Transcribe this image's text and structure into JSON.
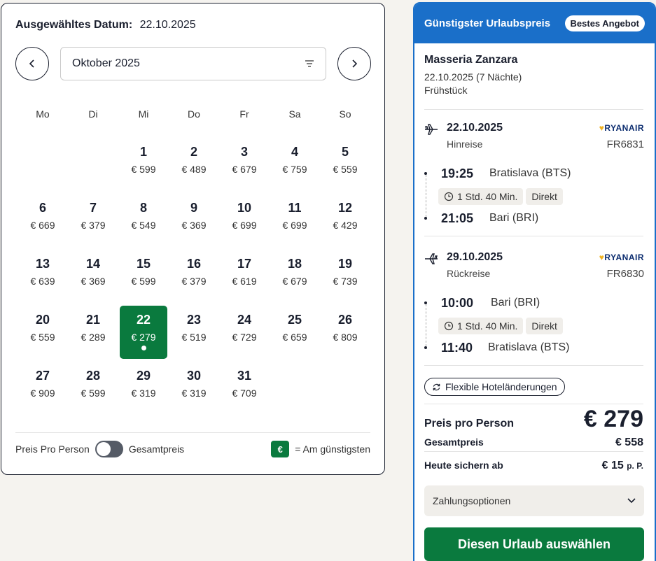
{
  "calendar": {
    "selected_label": "Ausgewähltes Datum:",
    "selected_value": "22.10.2025",
    "month": "Oktober 2025",
    "weekdays": [
      "Mo",
      "Di",
      "Mi",
      "Do",
      "Fr",
      "Sa",
      "So"
    ],
    "days": [
      {
        "d": "1",
        "p": "€ 599"
      },
      {
        "d": "2",
        "p": "€ 489"
      },
      {
        "d": "3",
        "p": "€ 679"
      },
      {
        "d": "4",
        "p": "€ 759"
      },
      {
        "d": "5",
        "p": "€ 559"
      },
      {
        "d": "6",
        "p": "€ 669"
      },
      {
        "d": "7",
        "p": "€ 379"
      },
      {
        "d": "8",
        "p": "€ 549"
      },
      {
        "d": "9",
        "p": "€ 369"
      },
      {
        "d": "10",
        "p": "€ 699"
      },
      {
        "d": "11",
        "p": "€ 699"
      },
      {
        "d": "12",
        "p": "€ 429"
      },
      {
        "d": "13",
        "p": "€ 639"
      },
      {
        "d": "14",
        "p": "€ 369"
      },
      {
        "d": "15",
        "p": "€ 599"
      },
      {
        "d": "16",
        "p": "€ 379"
      },
      {
        "d": "17",
        "p": "€ 619"
      },
      {
        "d": "18",
        "p": "€ 679"
      },
      {
        "d": "19",
        "p": "€ 739"
      },
      {
        "d": "20",
        "p": "€ 559"
      },
      {
        "d": "21",
        "p": "€ 289"
      },
      {
        "d": "22",
        "p": "€ 279",
        "selected": true
      },
      {
        "d": "23",
        "p": "€ 519"
      },
      {
        "d": "24",
        "p": "€ 729"
      },
      {
        "d": "25",
        "p": "€ 659"
      },
      {
        "d": "26",
        "p": "€ 809"
      },
      {
        "d": "27",
        "p": "€ 909"
      },
      {
        "d": "28",
        "p": "€ 599"
      },
      {
        "d": "29",
        "p": "€ 319"
      },
      {
        "d": "30",
        "p": "€ 319"
      },
      {
        "d": "31",
        "p": "€ 709"
      }
    ],
    "toggle_left": "Preis Pro Person",
    "toggle_right": "Gesamtpreis",
    "legend_symbol": "€",
    "legend_text": "= Am günstigsten"
  },
  "offer": {
    "header": "Günstigster Urlaubspreis",
    "badge": "Bestes Angebot",
    "hotel_name": "Masseria Zanzara",
    "hotel_dates": "22.10.2025 (7 Nächte)",
    "board": "Frühstück",
    "outbound": {
      "date": "22.10.2025",
      "direction": "Hinreise",
      "airline": "RYANAIR",
      "flight_no": "FR6831",
      "dep_time": "19:25",
      "dep_airport": "Bratislava (BTS)",
      "duration": "1 Std. 40 Min.",
      "stops": "Direkt",
      "arr_time": "21:05",
      "arr_airport": "Bari (BRI)"
    },
    "inbound": {
      "date": "29.10.2025",
      "direction": "Rückreise",
      "airline": "RYANAIR",
      "flight_no": "FR6830",
      "dep_time": "10:00",
      "dep_airport": "Bari (BRI)",
      "duration": "1 Std. 40 Min.",
      "stops": "Direkt",
      "arr_time": "11:40",
      "arr_airport": "Bratislava (BTS)"
    },
    "flexible": "Flexible Hoteländerungen",
    "price_per_person_label": "Preis pro Person",
    "price_per_person": "€ 279",
    "total_label": "Gesamtpreis",
    "total": "€ 558",
    "deposit_label": "Heute sichern ab",
    "deposit": "€ 15",
    "deposit_unit": "p. P.",
    "payment_options": "Zahlungsoptionen",
    "cta": "Diesen Urlaub auswählen"
  },
  "colors": {
    "accent_green": "#0a7a3e",
    "accent_blue": "#1a6fc9",
    "text": "#1a1f2e"
  }
}
